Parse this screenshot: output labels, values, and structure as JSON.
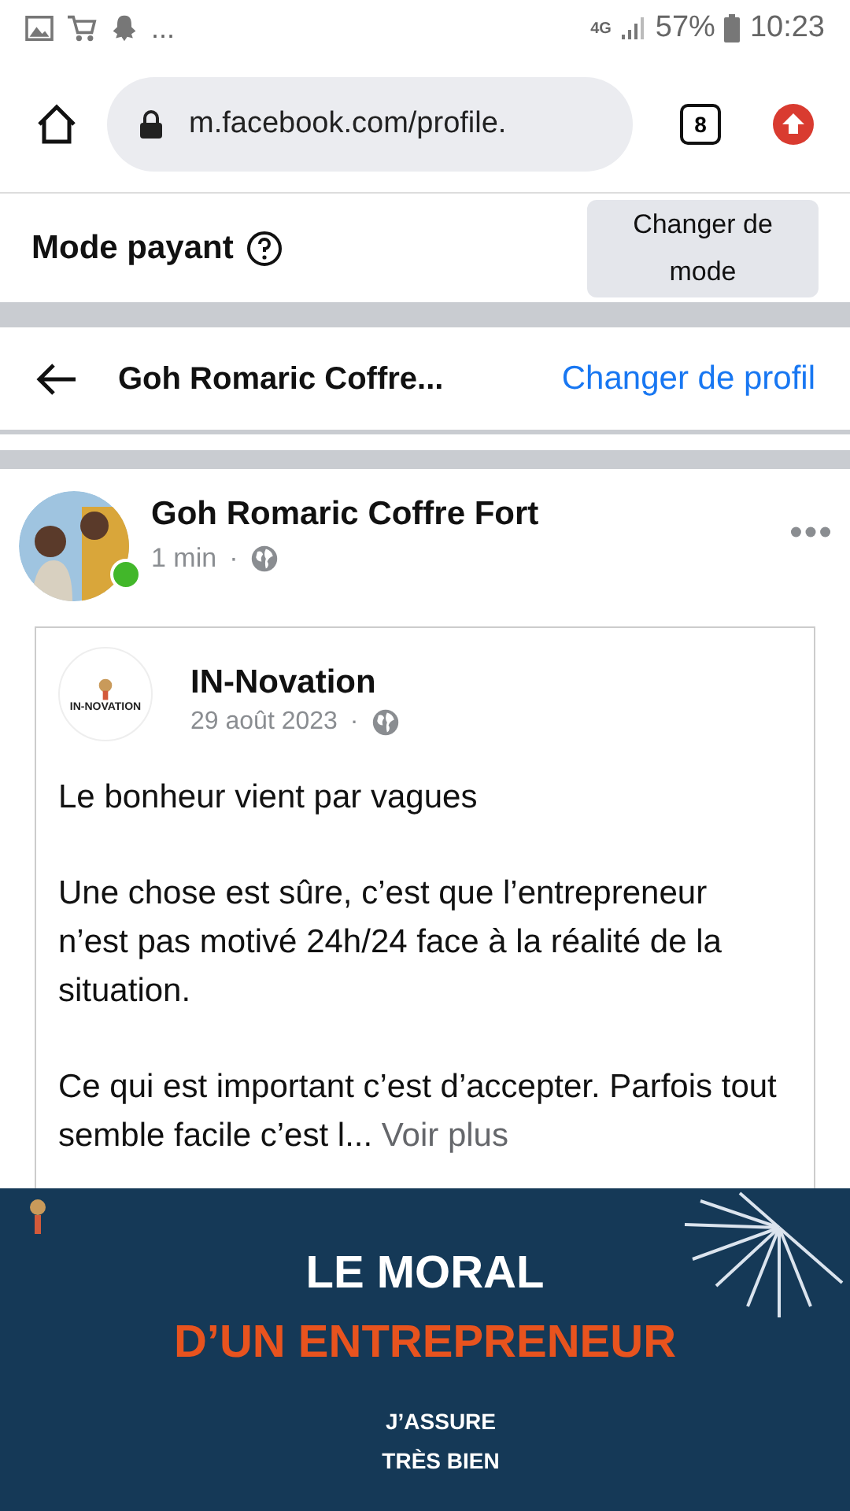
{
  "status_bar": {
    "notifications": "...",
    "network": "4G",
    "battery": "57%",
    "time": "10:23"
  },
  "browser": {
    "url": "m.facebook.com/profile.",
    "tab_count": "8"
  },
  "mode_bar": {
    "title": "Mode payant",
    "button": "Changer de mode"
  },
  "profile_header": {
    "name": "Goh Romaric Coffre...",
    "switch_link": "Changer de profil"
  },
  "post": {
    "author": "Goh Romaric Coffre Fort",
    "online": true,
    "time": "1 min",
    "separator": "·",
    "shared": {
      "page": "IN-Novation",
      "logo_text": "IN-NOVATION",
      "date": "29 août 2023",
      "separator": "·",
      "paragraphs": [
        "Le bonheur vient par vagues",
        "Une chose est sûre, c’est que l’entrepreneur n’est pas motivé 24h/24 face à la réalité de la situation.",
        "Ce qui est important c’est d’accepter. Parfois tout semble facile c’est l..."
      ],
      "see_more": "Voir plus"
    },
    "image": {
      "title": "LE MORAL",
      "subtitle": "D’UN ENTREPRENEUR",
      "labels": [
        "J’ASSURE",
        "TRÈS BIEN"
      ]
    }
  }
}
